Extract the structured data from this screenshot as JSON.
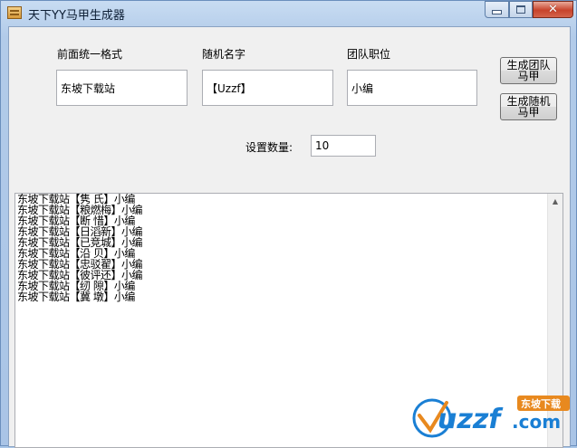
{
  "window": {
    "title": "天下YY马甲生成器"
  },
  "form": {
    "prefix_label": "前面统一格式",
    "prefix_value": "东坡下载站",
    "random_name_label": "随机名字",
    "random_name_value": "【Uzzf】",
    "role_label": "团队职位",
    "role_value": "小编",
    "count_label": "设置数量:",
    "count_value": "10"
  },
  "buttons": {
    "generate_team": "生成团队\n马甲",
    "generate_random": "生成随机\n马甲"
  },
  "output": {
    "lines": [
      "东坡下载站【隽  氏】小编",
      "东坡下载站【粮燃梅】小编",
      "东坡下载站【断  惜】小编",
      "东坡下载站【日滔新】小编",
      "东坡下载站【已竞城】小编",
      "东坡下载站【沿  贝】小编",
      "东坡下载站【忠驳翟】小编",
      "东坡下载站【彼评还】小编",
      "东坡下载站【纫  隙】小编",
      "东坡下载站【冀  墩】小编"
    ]
  },
  "watermark": {
    "brand": "uzzf",
    "domain": ".com",
    "tag": "东坡下载",
    "brand_color": "#1a7fd4",
    "accent_color": "#e8891f"
  },
  "icons": {
    "app": "app-icon",
    "minimize": "minimize-icon",
    "maximize": "maximize-icon",
    "close": "close-icon",
    "scroll_up": "scroll-up-arrow-icon"
  }
}
